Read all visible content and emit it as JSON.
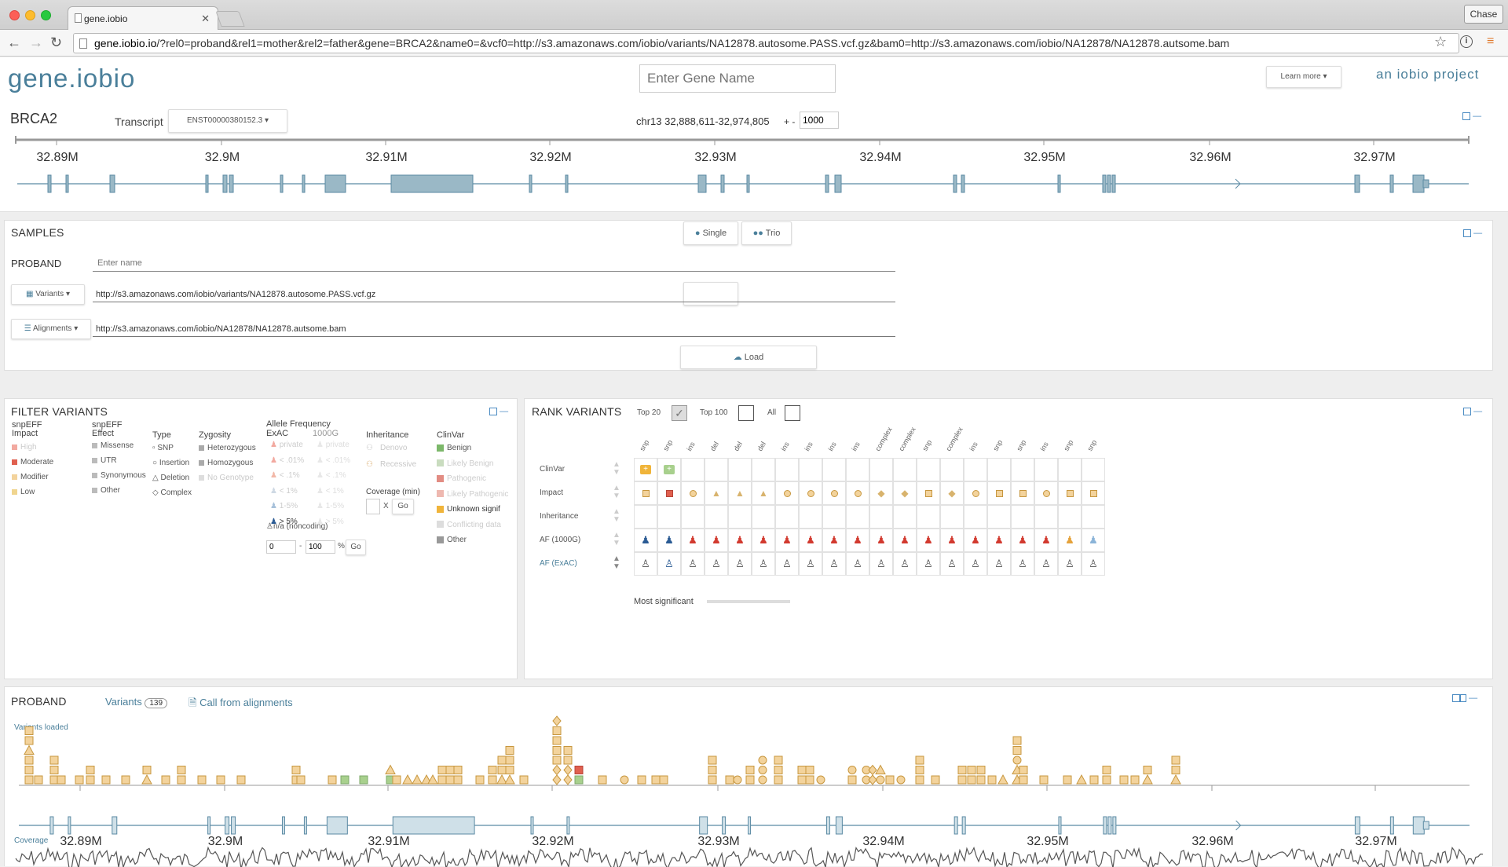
{
  "browser": {
    "tab_title": "gene.iobio",
    "user": "Chase",
    "url_host": "gene.iobio.io",
    "url_rest": "/?rel0=proband&rel1=mother&rel2=father&gene=BRCA2&name0=&vcf0=http://s3.amazonaws.com/iobio/variants/NA12878.autosome.PASS.vcf.gz&bam0=http://s3.amazonaws.com/iobio/NA12878/NA12878.autsome.bam"
  },
  "header": {
    "logo": "gene.iobio",
    "gene_placeholder": "Enter Gene Name",
    "learn_more": "Learn more",
    "project": "an iobio project"
  },
  "gene": {
    "name": "BRCA2",
    "transcript_label": "Transcript",
    "transcript": "ENST00000380152.3",
    "region": "chr13 32,888,611-32,974,805",
    "pad_label": "+ -",
    "pad_value": "1000",
    "axis_ticks": [
      "32.89M",
      "32.9M",
      "32.91M",
      "32.92M",
      "32.93M",
      "32.94M",
      "32.95M",
      "32.96M",
      "32.97M"
    ]
  },
  "samples": {
    "title": "SAMPLES",
    "single": "Single",
    "trio": "Trio",
    "proband": "PROBAND",
    "name_placeholder": "Enter name",
    "variants_btn": "Variants",
    "variants_url": "http://s3.amazonaws.com/iobio/variants/NA12878.autosome.PASS.vcf.gz",
    "alignments_btn": "Alignments",
    "alignments_url": "http://s3.amazonaws.com/iobio/NA12878/NA12878.autsome.bam",
    "load": "Load"
  },
  "filter": {
    "title": "FILTER VARIANTS",
    "impact_h1": "snpEFF",
    "impact_h2": "Impact",
    "impact": [
      "High",
      "Moderate",
      "Modifier",
      "Low"
    ],
    "effect_h1": "snpEFF",
    "effect_h2": "Effect",
    "effect": [
      "Missense",
      "UTR",
      "Synonymous",
      "Other"
    ],
    "type_h": "Type",
    "type": [
      "SNP",
      "Insertion",
      "Deletion",
      "Complex"
    ],
    "zyg_h": "Zygosity",
    "zyg": [
      "Heterozygous",
      "Homozygous",
      "No Genotype"
    ],
    "af_h": "Allele Frequency",
    "exac_h": "ExAC",
    "g1000_h": "1000G",
    "af_exac": [
      "private",
      "< .01%",
      "< .1%",
      "< 1%",
      "1-5%",
      "> 5%"
    ],
    "af_1000g": [
      "private",
      "< .01%",
      "< .1%",
      "< 1%",
      "1-5%",
      "> 5%"
    ],
    "na_noncoding": "n/a (noncoding)",
    "range_from": "0",
    "range_to": "100",
    "range_unit": "%",
    "go": "Go",
    "inh_h": "Inheritance",
    "inh": [
      "Denovo",
      "Recessive"
    ],
    "coverage_h": "Coverage (min)",
    "coverage_x": "X",
    "clinvar_h": "ClinVar",
    "clinvar": [
      "Benign",
      "Likely Benign",
      "Pathogenic",
      "Likely Pathogenic",
      "Unknown signif",
      "Conflicting data",
      "Other"
    ]
  },
  "rank": {
    "title": "RANK VARIANTS",
    "top20": "Top 20",
    "top100": "Top 100",
    "all": "All",
    "rows": [
      "ClinVar",
      "Impact",
      "Inheritance",
      "AF (1000G)",
      "AF (ExAC)"
    ],
    "cols": [
      "snp",
      "snp",
      "ins",
      "del",
      "del",
      "del",
      "ins",
      "ins",
      "ins",
      "ins",
      "complex",
      "complex",
      "snp",
      "complex",
      "ins",
      "snp",
      "snp",
      "ins",
      "snp",
      "snp"
    ],
    "impact_shapes": [
      "sq",
      "sq-red",
      "circ",
      "tri",
      "tri",
      "tri",
      "circ",
      "circ",
      "circ",
      "circ",
      "dia",
      "dia",
      "sq",
      "dia",
      "circ",
      "sq",
      "sq",
      "circ",
      "sq",
      "sq"
    ],
    "most_significant": "Most significant"
  },
  "proband": {
    "title": "PROBAND",
    "variants_label": "Variants",
    "variants_count": "139",
    "call_link": "Call from alignments",
    "variants_loaded": "Variants loaded",
    "coverage": "Coverage",
    "axis_ticks": [
      "32.89M",
      "32.9M",
      "32.91M",
      "32.92M",
      "32.93M",
      "32.94M",
      "32.95M",
      "32.96M",
      "32.97M"
    ]
  },
  "colors": {
    "accent": "#4a7f9a",
    "exon_fill": "#9ab8c6",
    "variant_fill": "#f3d39c",
    "variant_stroke": "#c7973f",
    "high_red": "#e0604f",
    "green": "#a8d08d"
  }
}
